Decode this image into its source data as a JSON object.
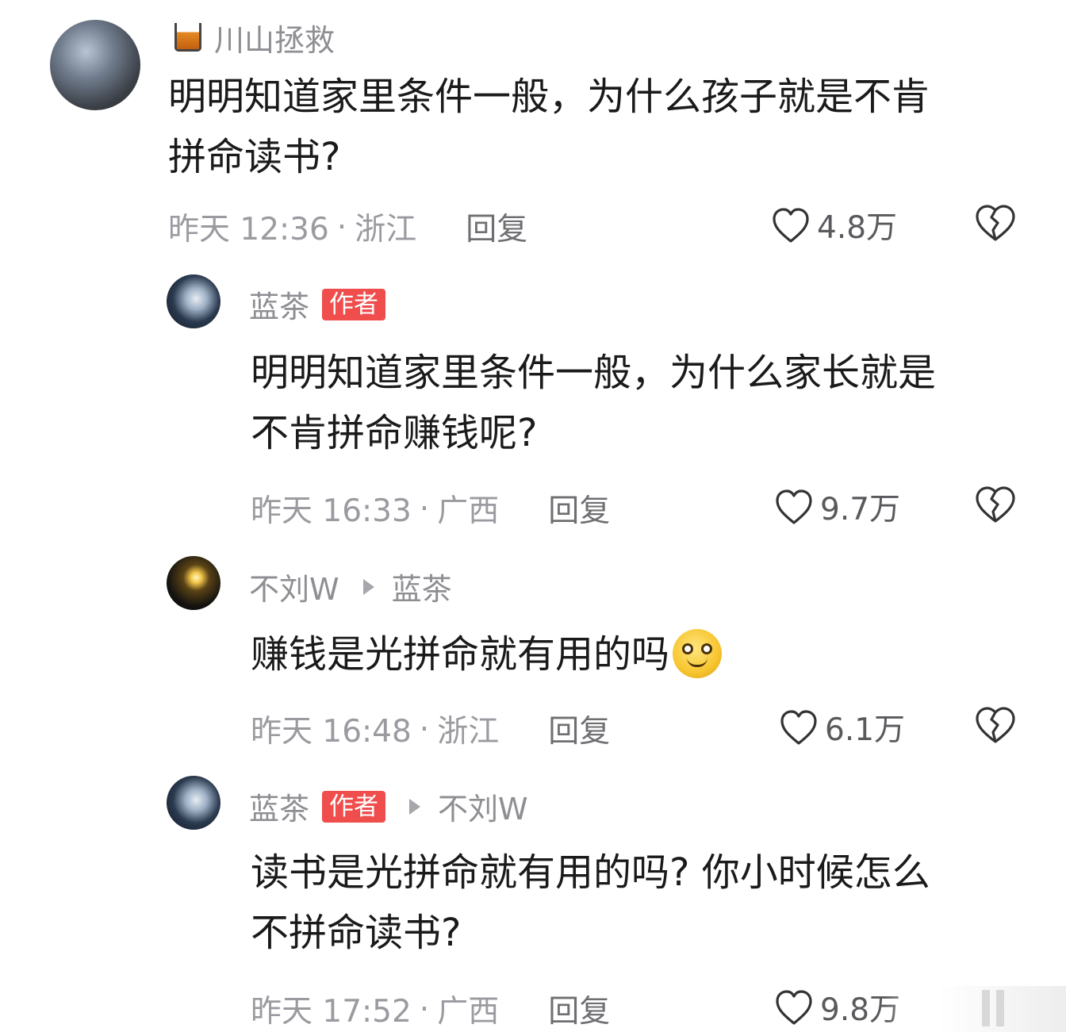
{
  "comments": [
    {
      "username": "川山拯救",
      "text_lines": [
        "明明知道家里条件一般，为什么孩子就是不肯",
        "拼命读书?"
      ],
      "time": "昨天 12:36",
      "location": "浙江",
      "reply_label": "回复",
      "likes": "4.8万"
    },
    {
      "username": "蓝茶",
      "badge": "作者",
      "text_lines": [
        "明明知道家里条件一般，为什么家长就是",
        "不肯拼命赚钱呢?"
      ],
      "time": "昨天 16:33",
      "location": "广西",
      "reply_label": "回复",
      "likes": "9.7万"
    },
    {
      "username": "不刘W",
      "reply_to": "蓝茶",
      "text_lines": [
        "赚钱是光拼命就有用的吗"
      ],
      "emoji": "smiling-face-emoji",
      "time": "昨天 16:48",
      "location": "浙江",
      "reply_label": "回复",
      "likes": "6.1万"
    },
    {
      "username": "蓝茶",
      "badge": "作者",
      "reply_to": "不刘W",
      "text_lines": [
        "读书是光拼命就有用的吗? 你小时候怎么",
        "不拼命读书?"
      ],
      "time": "昨天 17:52",
      "location": "广西",
      "reply_label": "回复",
      "likes": "9.8万"
    }
  ],
  "separator": "·",
  "colors": {
    "badge": "#f04d4d",
    "meta": "#9a9aa0",
    "text": "#1a1a1a"
  }
}
